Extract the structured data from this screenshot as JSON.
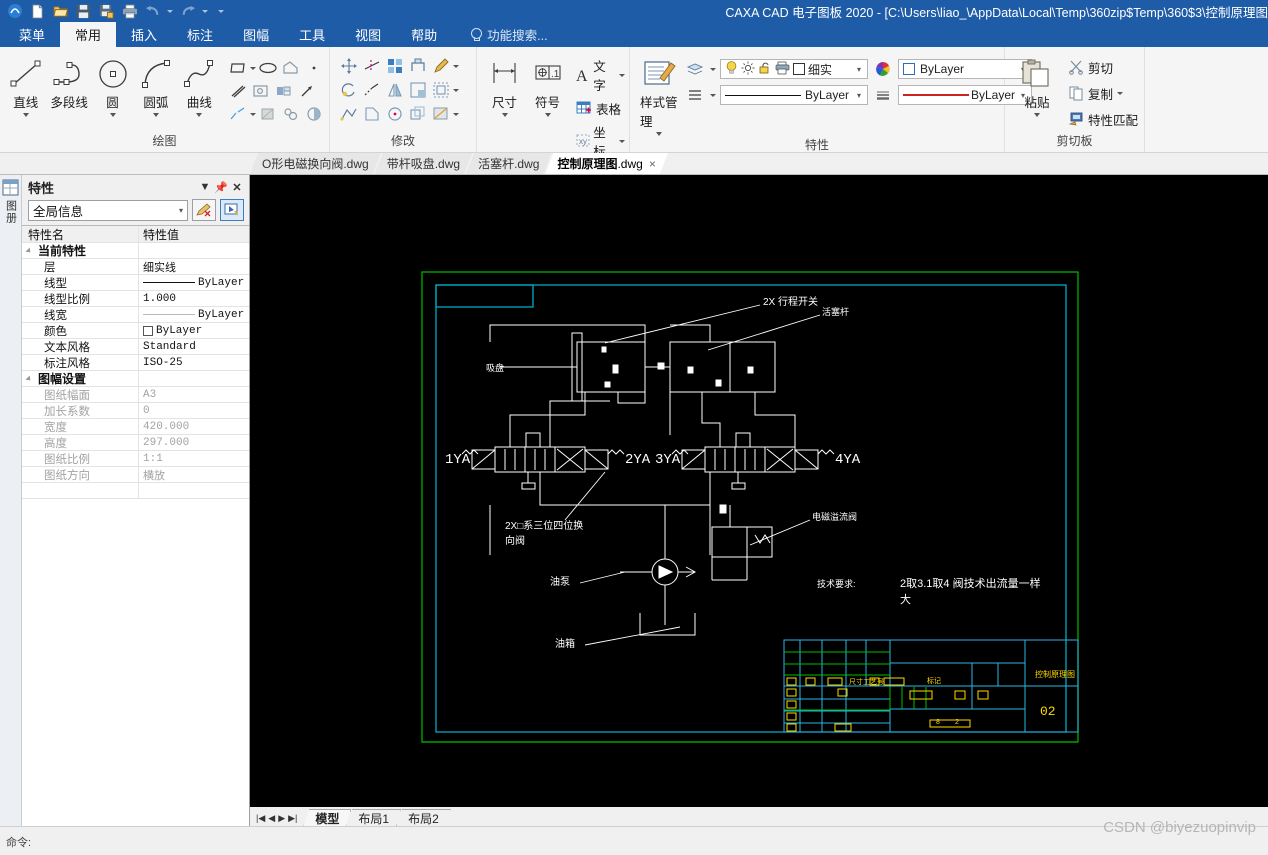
{
  "window": {
    "title": "CAXA CAD 电子图板 2020 - [C:\\Users\\liao_\\AppData\\Local\\Temp\\360zip$Temp\\360$3\\控制原理图",
    "quick_access": [
      "new-icon",
      "open-icon",
      "save-icon",
      "save-as-icon",
      "print-icon",
      "undo-icon",
      "redo-icon",
      "customize-icon"
    ]
  },
  "ribbon": {
    "tabs": [
      {
        "label": "菜单",
        "active": false
      },
      {
        "label": "常用",
        "active": true
      },
      {
        "label": "插入",
        "active": false
      },
      {
        "label": "标注",
        "active": false
      },
      {
        "label": "图幅",
        "active": false
      },
      {
        "label": "工具",
        "active": false
      },
      {
        "label": "视图",
        "active": false
      },
      {
        "label": "帮助",
        "active": false
      }
    ],
    "search_placeholder": "功能搜索...",
    "groups": {
      "draw": {
        "title": "绘图",
        "big_buttons": [
          {
            "label": "直线",
            "icon": "line-icon"
          },
          {
            "label": "多段线",
            "icon": "polyline-icon"
          },
          {
            "label": "圆",
            "icon": "circle-icon"
          },
          {
            "label": "圆弧",
            "icon": "arc-icon"
          },
          {
            "label": "曲线",
            "icon": "spline-icon"
          }
        ],
        "small_icons": [
          "rectangle-icon",
          "ellipse-icon",
          "polygon-icon",
          "point-icon",
          "parallel-line-icon",
          "image-icon",
          "block-icon",
          "arrow-icon",
          "centerline-icon",
          "hatch-icon",
          "puzzle-icon",
          "fill-icon"
        ]
      },
      "modify": {
        "title": "修改",
        "small_icons": [
          "move-icon",
          "trim-icon",
          "array-icon",
          "copy-move-icon",
          "edit-pencil-icon",
          "rotate-icon",
          "extend-icon",
          "mirror-icon",
          "fillet-icon",
          "offset-icon",
          "stretch-icon",
          "chamfer-icon",
          "break-icon",
          "scale-icon",
          "explode-icon"
        ]
      },
      "annotate": {
        "title": "标注",
        "big_buttons": [
          {
            "label": "尺寸",
            "icon": "dimension-icon"
          },
          {
            "label": "符号",
            "icon": "symbol-icon"
          }
        ],
        "items": [
          {
            "label": "文字",
            "icon": "text-A-icon"
          },
          {
            "label": "表格",
            "icon": "table-icon"
          },
          {
            "label": "坐标",
            "icon": "coordinate-icon"
          }
        ]
      },
      "properties": {
        "title": "特性",
        "style_manager": {
          "label": "样式管理",
          "icon": "style-manager-icon"
        },
        "layer_icon": "layer-icon",
        "linetype_icon": "linetype-list-icon",
        "layer_state_icons": [
          "bulb-icon",
          "sun-icon",
          "lock-icon",
          "print-icon",
          "color-box-icon"
        ],
        "layer_value": "细实",
        "color_value": "ByLayer",
        "linetype_value": "ByLayer",
        "lineweight_value": "ByLayer"
      },
      "clipboard": {
        "title": "剪切板",
        "paste": {
          "label": "粘贴",
          "icon": "paste-icon"
        },
        "items": [
          {
            "label": "剪切",
            "icon": "cut-scissors-icon"
          },
          {
            "label": "复制",
            "icon": "copy-icon"
          },
          {
            "label": "特性匹配",
            "icon": "match-properties-icon"
          }
        ]
      }
    }
  },
  "doc_tabs": [
    {
      "name": "O形电磁换向阀",
      "ext": ".dwg",
      "active": false
    },
    {
      "name": "带杆吸盘",
      "ext": ".dwg",
      "active": false
    },
    {
      "name": "活塞杆",
      "ext": ".dwg",
      "active": false
    },
    {
      "name": "控制原理图",
      "ext": ".dwg",
      "active": true,
      "close": "×"
    }
  ],
  "left_strip": {
    "icon": "properties-panel-icon",
    "label": "图册"
  },
  "property_panel": {
    "title": "特性",
    "header_buttons": [
      "chevron-down-icon",
      "pin-icon",
      "close-icon"
    ],
    "filter_value": "全局信息",
    "toolbar_buttons": [
      "clear-selection-icon",
      "quick-select-icon"
    ],
    "columns": [
      "特性名",
      "特性值"
    ],
    "groups": [
      {
        "name": "当前特性",
        "dim": false,
        "rows": [
          {
            "name": "层",
            "value": "细实线",
            "type": "text"
          },
          {
            "name": "线型",
            "value": "ByLayer",
            "type": "linetype"
          },
          {
            "name": "线型比例",
            "value": "1.000",
            "type": "text"
          },
          {
            "name": "线宽",
            "value": "ByLayer",
            "type": "lineweight"
          },
          {
            "name": "颜色",
            "value": "ByLayer",
            "type": "color"
          },
          {
            "name": "文本风格",
            "value": "Standard",
            "type": "text"
          },
          {
            "name": "标注风格",
            "value": "ISO-25",
            "type": "text"
          }
        ]
      },
      {
        "name": "图幅设置",
        "dim": true,
        "rows": [
          {
            "name": "图纸幅面",
            "value": "A3",
            "type": "text"
          },
          {
            "name": "加长系数",
            "value": "0",
            "type": "text"
          },
          {
            "name": "宽度",
            "value": "420.000",
            "type": "text"
          },
          {
            "name": "高度",
            "value": "297.000",
            "type": "text"
          },
          {
            "name": "图纸比例",
            "value": "1:1",
            "type": "text"
          },
          {
            "name": "图纸方向",
            "value": "横放",
            "type": "text"
          }
        ]
      }
    ]
  },
  "drawing": {
    "labels": {
      "limit_switch": "2X 行程开关",
      "piston_rod": "活塞杆",
      "suction_cup": "吸盘",
      "valve_note_line1": "2X□系三位四位换",
      "valve_note_line2": "向阀",
      "solenoid_relief_valve": "电磁溢流阀",
      "pump": "油泵",
      "tank": "油箱",
      "tech_title": "技术要求:",
      "tech_line1": "2取3.1取4 阀技术出流量一样",
      "tech_line2": "大",
      "solenoid_1": "1YA",
      "solenoid_2": "2YA",
      "solenoid_3": "3YA",
      "solenoid_4": "4YA"
    },
    "title_block": {
      "drawing_name": "控制原理图",
      "sheet_number": "02"
    },
    "colors": {
      "background": "#000000",
      "geometry": "#ffffff",
      "frame_outer": "#00b000",
      "frame_inner": "#00b7d4",
      "title_grid": "#29b6e8",
      "title_grid_alt": "#00c000",
      "title_text": "#ffd800"
    }
  },
  "model_tabs": {
    "nav_buttons": [
      "first-icon",
      "prev-icon",
      "next-icon",
      "last-icon"
    ],
    "tabs": [
      {
        "label": "模型",
        "active": true
      },
      {
        "label": "布局1",
        "active": false
      },
      {
        "label": "布局2",
        "active": false
      }
    ]
  },
  "status": {
    "command_prompt": "命令:",
    "watermark": "CSDN @biyezuopinvip"
  }
}
